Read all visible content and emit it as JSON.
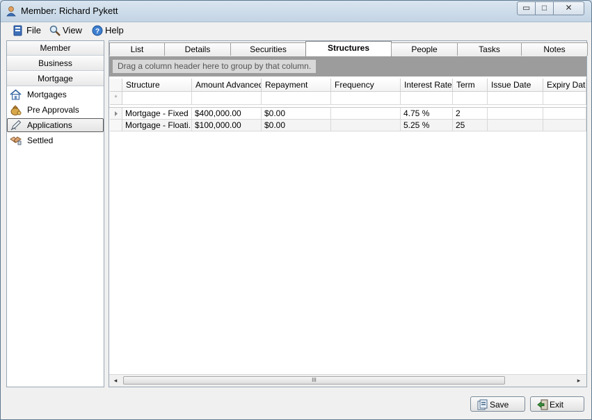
{
  "window": {
    "title": "Member: Richard Pykett"
  },
  "window_controls": {
    "minimize": "▭",
    "maximize": "□",
    "close": "✕"
  },
  "menu": {
    "file": "File",
    "view": "View",
    "help": "Help"
  },
  "sidebar": {
    "tabs": [
      "Member",
      "Business",
      "Mortgage"
    ],
    "items": [
      {
        "label": "Mortgages",
        "icon": "house-icon"
      },
      {
        "label": "Pre Approvals",
        "icon": "money-bag-icon"
      },
      {
        "label": "Applications",
        "icon": "pen-icon"
      },
      {
        "label": "Settled",
        "icon": "handshake-icon"
      }
    ],
    "selected": "Applications"
  },
  "tabs": [
    "List",
    "Details",
    "Securities",
    "Structures",
    "People",
    "Tasks",
    "Notes"
  ],
  "active_tab": "Structures",
  "group_hint": "Drag a column header here to group by that column.",
  "grid": {
    "new_row_marker": "*",
    "columns": [
      "Structure",
      "Amount Advanced",
      "Repayment",
      "Frequency",
      "Interest Rate",
      "Term",
      "Issue Date",
      "Expiry Date"
    ],
    "rows": [
      {
        "structure": "Mortgage - Fixed",
        "amount_advanced": "$400,000.00",
        "repayment": "$0.00",
        "frequency": "",
        "interest_rate": "4.75 %",
        "term": "2",
        "issue_date": "",
        "expiry_date": ""
      },
      {
        "structure": "Mortgage - Floati...",
        "amount_advanced": "$100,000.00",
        "repayment": "$0.00",
        "frequency": "",
        "interest_rate": "5.25 %",
        "term": "25",
        "issue_date": "",
        "expiry_date": ""
      }
    ]
  },
  "scrollbar": {
    "left": "◂",
    "right": "▸",
    "grip": "III"
  },
  "footer": {
    "save": "Save",
    "exit": "Exit"
  }
}
